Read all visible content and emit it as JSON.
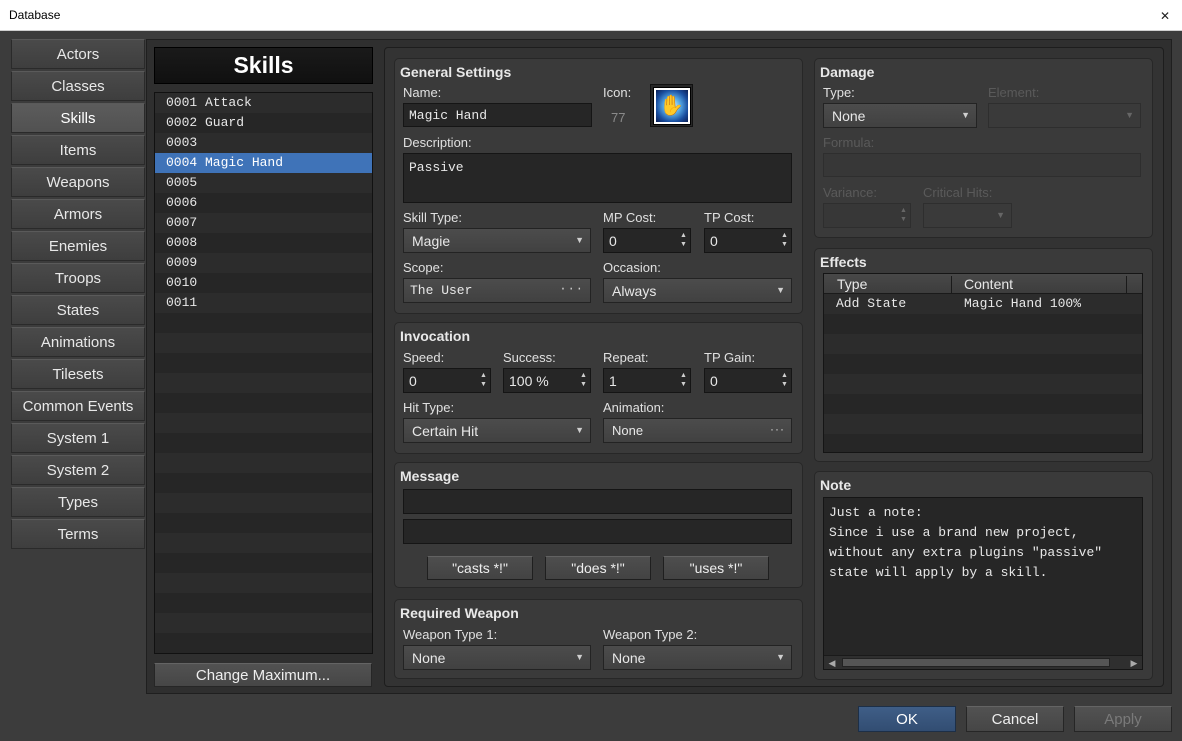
{
  "window": {
    "title": "Database",
    "close_glyph": "✕"
  },
  "categories": [
    "Actors",
    "Classes",
    "Skills",
    "Items",
    "Weapons",
    "Armors",
    "Enemies",
    "Troops",
    "States",
    "Animations",
    "Tilesets",
    "Common Events",
    "System 1",
    "System 2",
    "Types",
    "Terms"
  ],
  "selected_category": "Skills",
  "list": {
    "header": "Skills",
    "items": [
      "0001 Attack",
      "0002 Guard",
      "0003",
      "0004 Magic Hand",
      "0005",
      "0006",
      "0007",
      "0008",
      "0009",
      "0010",
      "0011"
    ],
    "selected_index": 3,
    "change_max_label": "Change Maximum..."
  },
  "general": {
    "title": "General Settings",
    "name_label": "Name:",
    "name_value": "Magic Hand",
    "icon_label": "Icon:",
    "icon_index": "77",
    "icon_name": "magic-hand-icon",
    "description_label": "Description:",
    "description_value": "Passive",
    "skill_type_label": "Skill Type:",
    "skill_type_value": "Magie",
    "mp_cost_label": "MP Cost:",
    "mp_cost_value": "0",
    "tp_cost_label": "TP Cost:",
    "tp_cost_value": "0",
    "scope_label": "Scope:",
    "scope_value": "The User",
    "occasion_label": "Occasion:",
    "occasion_value": "Always"
  },
  "invocation": {
    "title": "Invocation",
    "speed_label": "Speed:",
    "speed_value": "0",
    "success_label": "Success:",
    "success_value": "100 %",
    "repeat_label": "Repeat:",
    "repeat_value": "1",
    "tp_gain_label": "TP Gain:",
    "tp_gain_value": "0",
    "hit_type_label": "Hit Type:",
    "hit_type_value": "Certain Hit",
    "animation_label": "Animation:",
    "animation_value": "None"
  },
  "message": {
    "title": "Message",
    "line1": "",
    "line2": "",
    "btn_casts": "\"casts *!\"",
    "btn_does": "\"does *!\"",
    "btn_uses": "\"uses *!\""
  },
  "required_weapon": {
    "title": "Required Weapon",
    "type1_label": "Weapon Type 1:",
    "type1_value": "None",
    "type2_label": "Weapon Type 2:",
    "type2_value": "None"
  },
  "damage": {
    "title": "Damage",
    "type_label": "Type:",
    "type_value": "None",
    "element_label": "Element:",
    "element_value": "",
    "formula_label": "Formula:",
    "formula_value": "",
    "variance_label": "Variance:",
    "variance_value": "",
    "critical_label": "Critical Hits:",
    "critical_value": ""
  },
  "effects": {
    "title": "Effects",
    "columns": [
      "Type",
      "Content"
    ],
    "rows": [
      {
        "type": "Add State",
        "content": "Magic Hand 100%"
      }
    ]
  },
  "note": {
    "title": "Note",
    "text": "Just a note:\nSince i use a brand new project, without any extra plugins \"passive\" state will apply by a skill."
  },
  "buttons": {
    "ok": "OK",
    "cancel": "Cancel",
    "apply": "Apply"
  },
  "colors": {
    "selection": "#3f73b8",
    "ok_button": "#3f5e87",
    "panel": "#3a3a3a"
  }
}
